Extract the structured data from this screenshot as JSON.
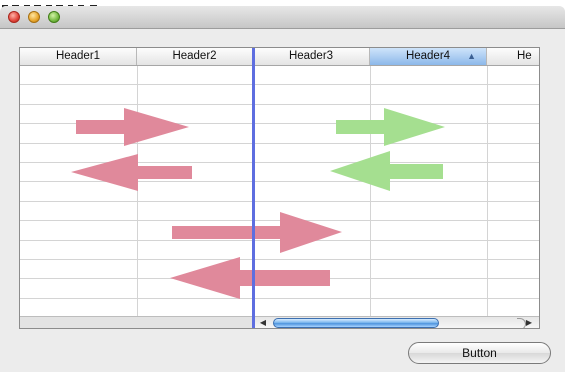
{
  "table": {
    "headers": [
      {
        "label": "Header1",
        "selected": false
      },
      {
        "label": "Header2",
        "selected": false
      },
      {
        "label": "Header3",
        "selected": false
      },
      {
        "label": "Header4",
        "selected": true,
        "sort": "ascending"
      },
      {
        "label": "He",
        "selected": false
      }
    ],
    "row_count": 13
  },
  "arrows": {
    "pink_color": "#e0899b",
    "green_color": "#a5df90"
  },
  "footer": {
    "button_label": "Button"
  }
}
